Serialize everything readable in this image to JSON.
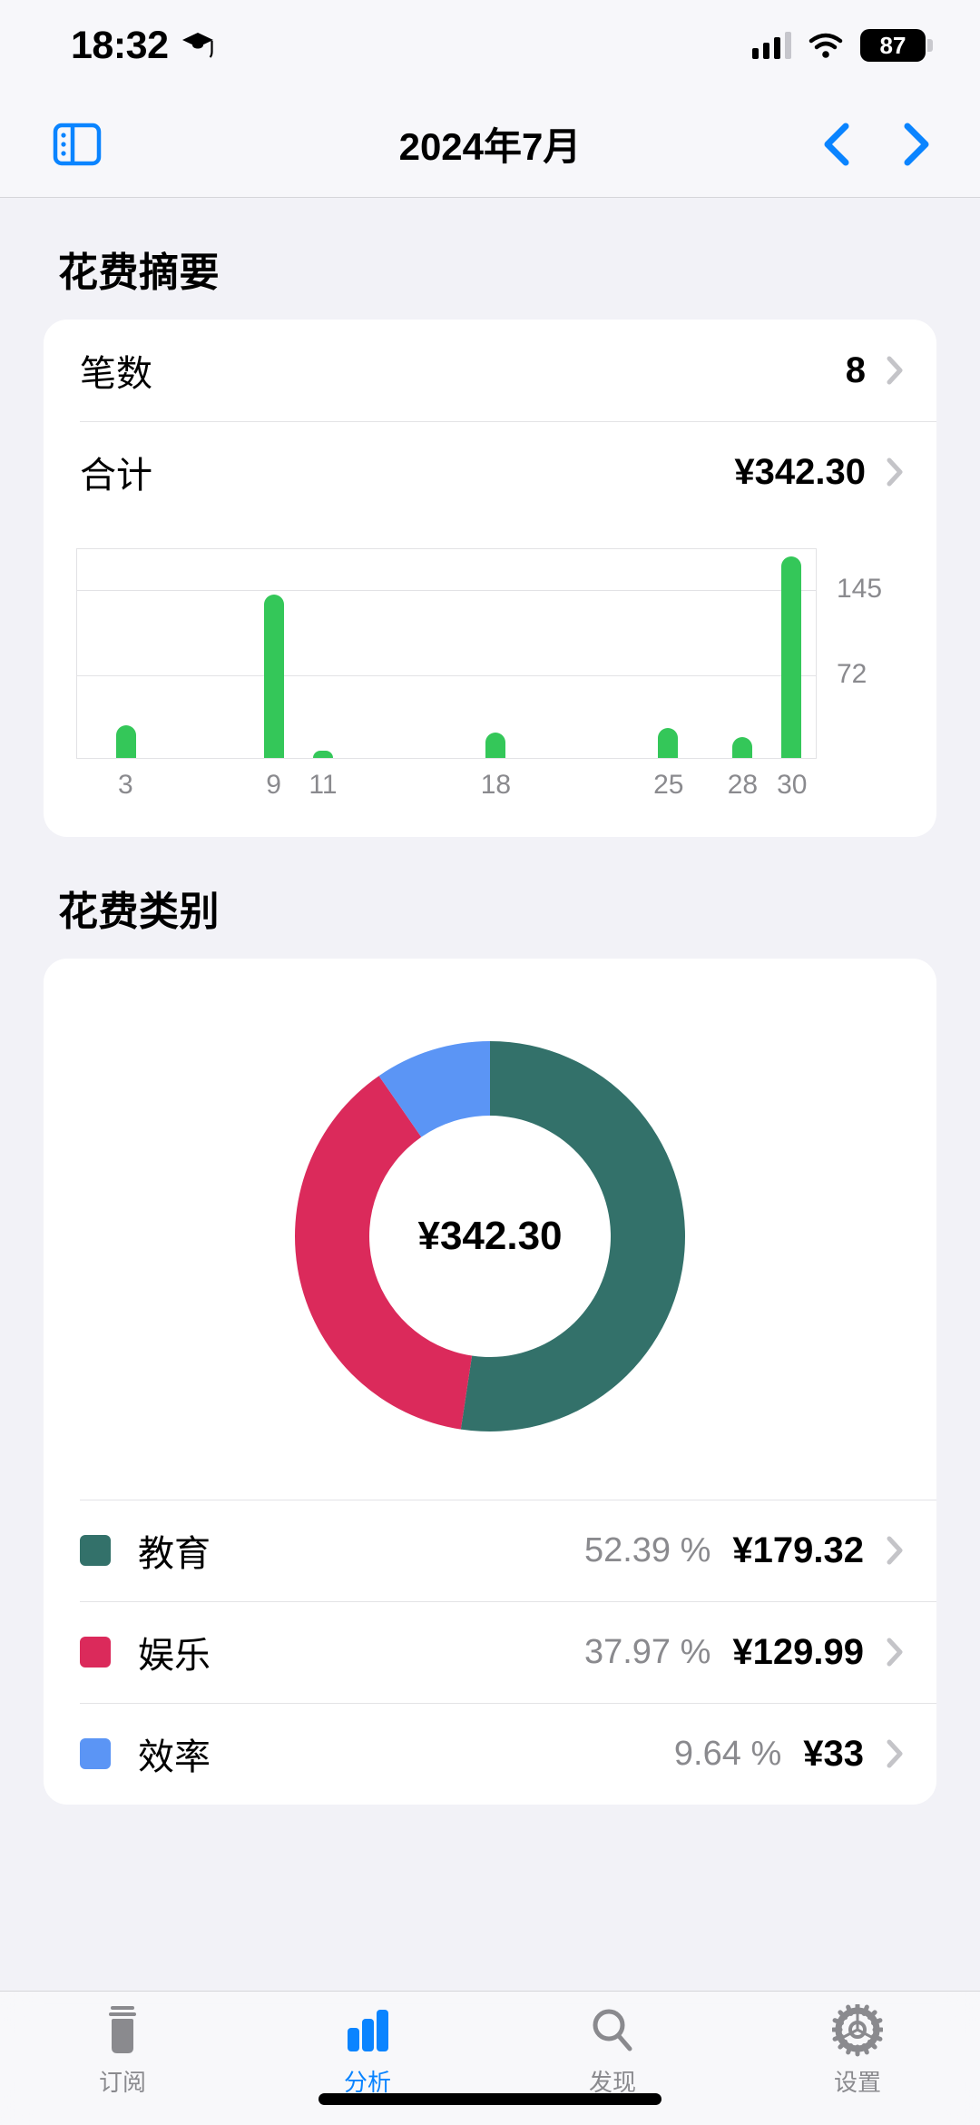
{
  "status_bar": {
    "time": "18:32",
    "focus_icon": "graduation-cap-icon",
    "signal_icon": "cellular-signal-icon",
    "wifi_icon": "wifi-icon",
    "battery_level": "87"
  },
  "nav": {
    "sidebar_icon": "sidebar-toggle-icon",
    "title": "2024年7月",
    "prev_icon": "chevron-left-icon",
    "next_icon": "chevron-right-icon"
  },
  "summary": {
    "section_title": "花费摘要",
    "rows": [
      {
        "label": "笔数",
        "value": "8"
      },
      {
        "label": "合计",
        "value": "¥342.30"
      }
    ]
  },
  "categories": {
    "section_title": "花费类别",
    "center_total": "¥342.30",
    "percent_symbol": "%",
    "items": [
      {
        "name": "教育",
        "percent": "52.39",
        "amount": "¥179.32",
        "color": "#33716A"
      },
      {
        "name": "娱乐",
        "percent": "37.97",
        "amount": "¥129.99",
        "color": "#DB2A5B"
      },
      {
        "name": "效率",
        "percent": "9.64",
        "amount": "¥33",
        "color": "#5B95F5"
      }
    ]
  },
  "tabbar": {
    "items": [
      {
        "label": "订阅",
        "icon": "jar-icon",
        "active": false
      },
      {
        "label": "分析",
        "icon": "bar-chart-icon",
        "active": true
      },
      {
        "label": "发现",
        "icon": "search-icon",
        "active": false
      },
      {
        "label": "设置",
        "icon": "gear-icon",
        "active": false
      }
    ]
  },
  "colors": {
    "accent": "#0A84FF",
    "bar_green": "#34C759",
    "page_bg": "#F2F2F7",
    "card_bg": "#FFFFFF",
    "muted_text": "#8A8A8E"
  },
  "chart_data": [
    {
      "type": "bar",
      "title": "",
      "xlabel": "",
      "ylabel": "",
      "categories": [
        "3",
        "9",
        "11",
        "18",
        "25",
        "28",
        "30"
      ],
      "values": [
        28,
        140,
        6,
        22,
        26,
        18,
        172
      ],
      "ylim": [
        0,
        180
      ],
      "yticks": [
        72,
        145
      ],
      "ytick_labels": [
        "72",
        "145"
      ],
      "grid": true,
      "legend": "none",
      "series_color": "#34C759"
    },
    {
      "type": "pie",
      "title": "花费类别",
      "center_label": "¥342.30",
      "labels": [
        "教育",
        "娱乐",
        "效率"
      ],
      "values": [
        179.32,
        129.99,
        33.0
      ],
      "percents": [
        52.39,
        37.97,
        9.64
      ],
      "colors": [
        "#33716A",
        "#DB2A5B",
        "#5B95F5"
      ],
      "donut": true,
      "legend": "bottom"
    }
  ]
}
